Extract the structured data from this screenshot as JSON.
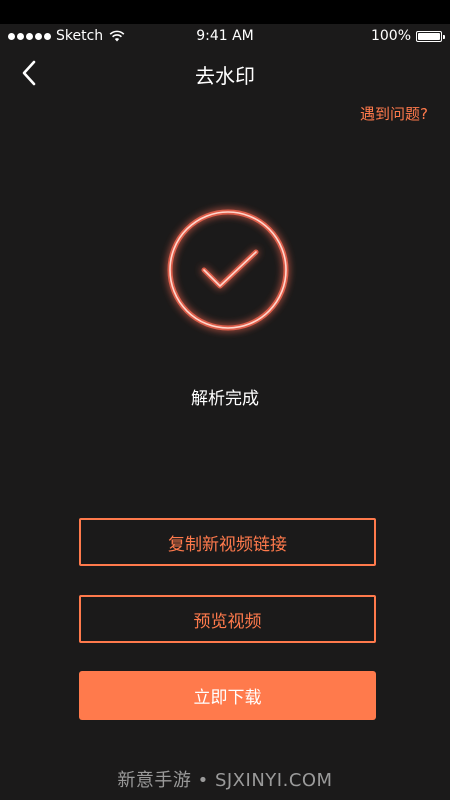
{
  "status_bar": {
    "carrier": "Sketch",
    "time": "9:41 AM",
    "battery": "100%",
    "battery_level": 1.0
  },
  "nav": {
    "title": "去水印",
    "back_icon": "chevron-left-icon"
  },
  "help_link": "遇到问题?",
  "result": {
    "icon": "check-circle-icon",
    "status": "解析完成"
  },
  "actions": {
    "copy_link": "复制新视频链接",
    "preview": "预览视频",
    "download": "立即下载"
  },
  "footer_watermark": "新意手游 • SJXINYI.COM",
  "colors": {
    "background": "#1b1a1a",
    "accent": "#ff7a4c",
    "text": "#ffffff"
  }
}
